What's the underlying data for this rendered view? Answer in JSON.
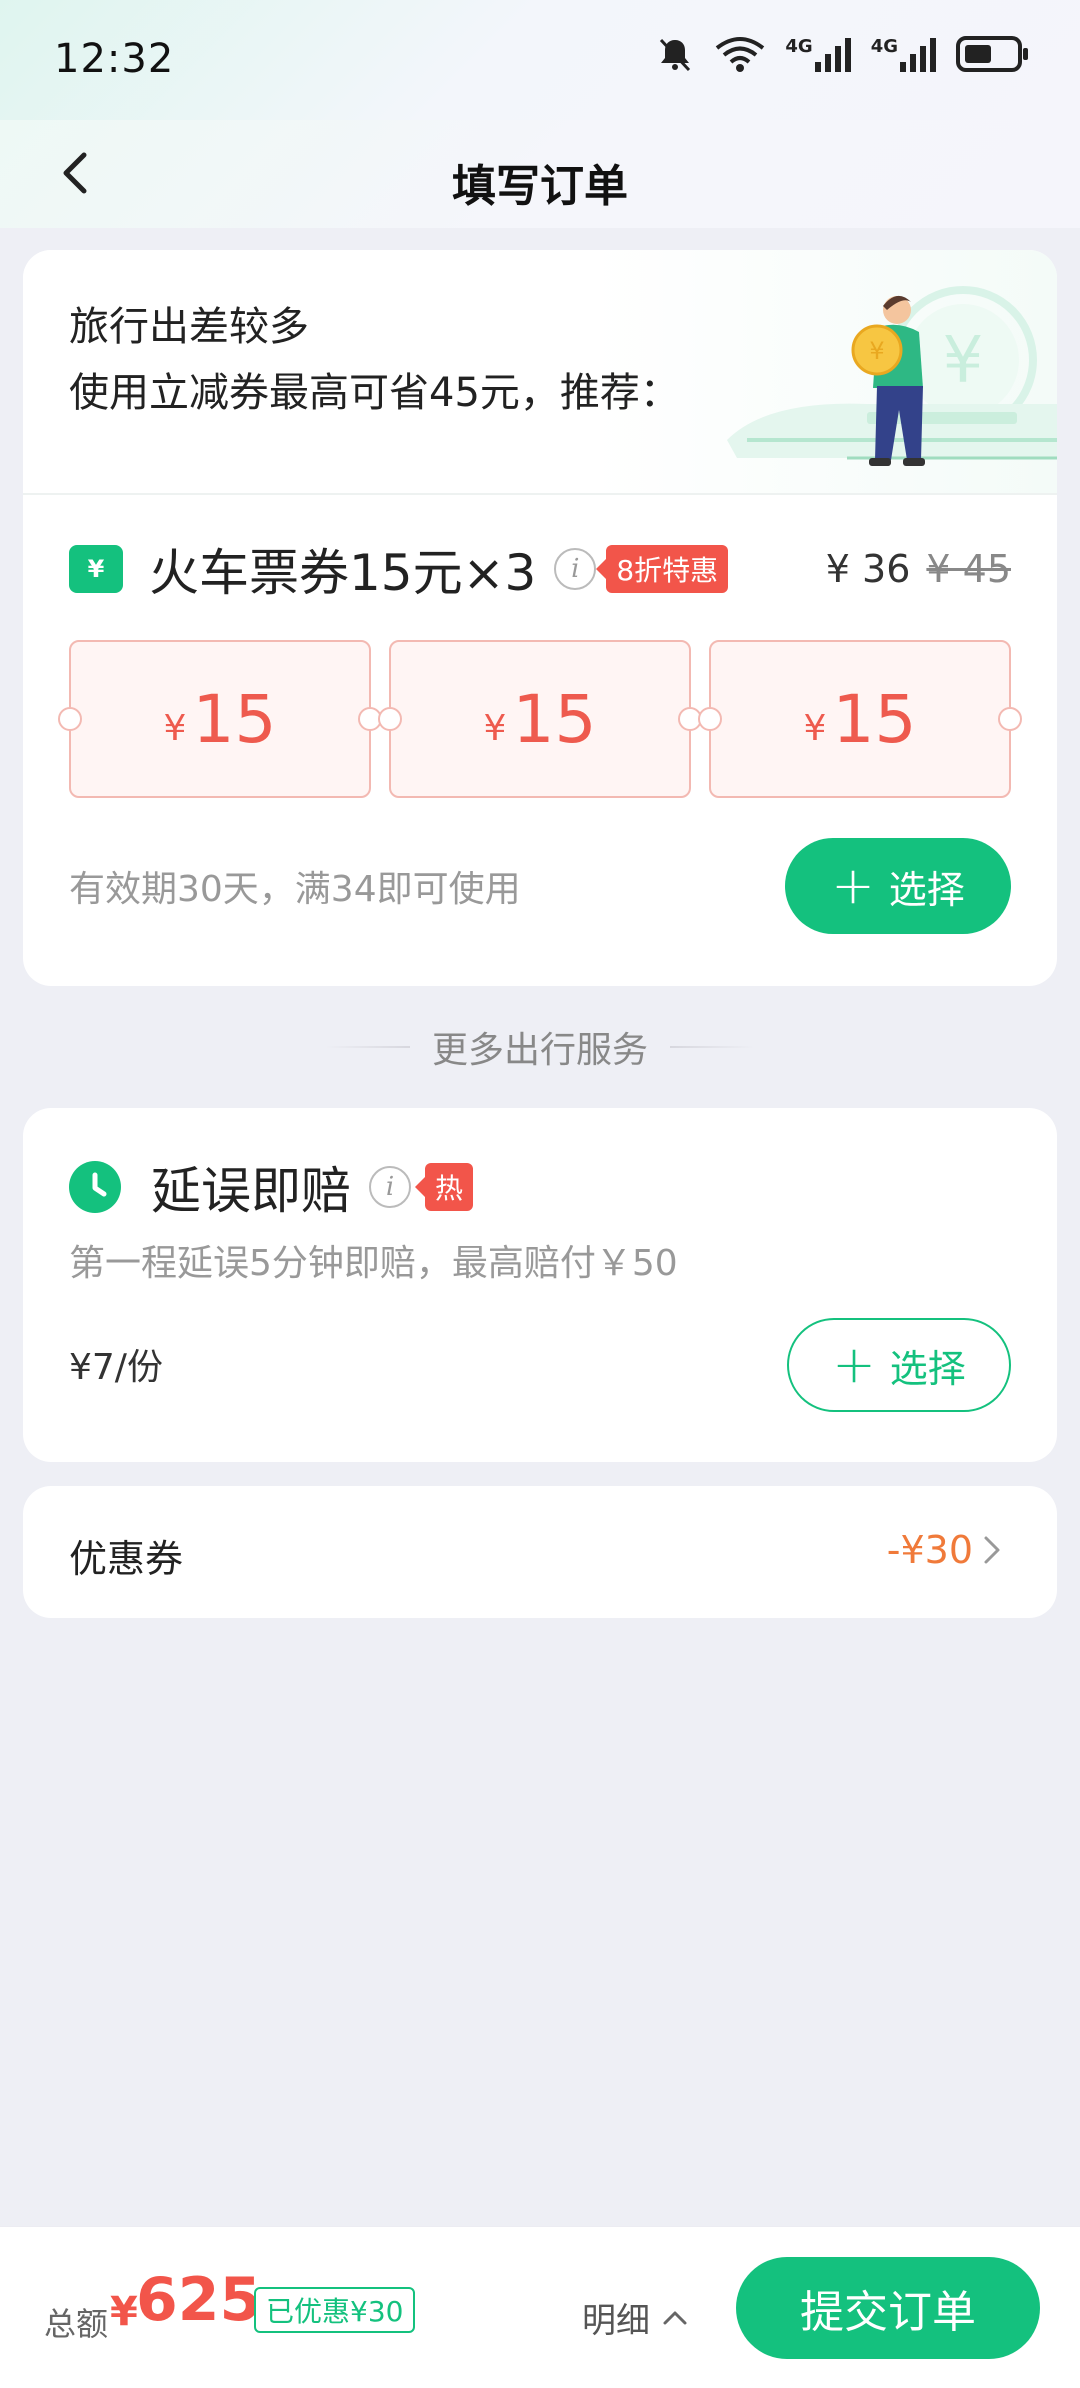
{
  "status_bar": {
    "time": "12:32",
    "icons": [
      "mute-bell-icon",
      "wifi-icon",
      "signal-4g-icon",
      "signal-4g-icon",
      "battery-icon"
    ],
    "network_labels": [
      "4G",
      "4G"
    ]
  },
  "header": {
    "title": "填写订单",
    "back_icon": "chevron-left-icon"
  },
  "promo": {
    "line1": "旅行出差较多",
    "line2": "使用立减券最高可省45元，推荐："
  },
  "coupon_package": {
    "title": "火车票券15元×3",
    "discount_badge": "8折特惠",
    "price_now": "¥ 36",
    "price_old": "¥ 45",
    "coupons": [
      {
        "currency": "¥",
        "amount": "15"
      },
      {
        "currency": "¥",
        "amount": "15"
      },
      {
        "currency": "¥",
        "amount": "15"
      }
    ],
    "validity": "有效期30天，满34即可使用",
    "select_label": "选择"
  },
  "section_divider": "更多出行服务",
  "delay_service": {
    "title": "延误即赔",
    "hot_badge": "热",
    "description": "第一程延误5分钟即赔，最高赔付￥50",
    "price": "¥7/份",
    "select_label": "选择"
  },
  "voucher": {
    "label": "优惠券",
    "value": "-¥30"
  },
  "bottom_bar": {
    "total_label": "总额",
    "currency": "¥",
    "total_amount": "625",
    "saved_badge": "已优惠¥30",
    "detail_label": "明细",
    "submit_label": "提交订单"
  },
  "colors": {
    "accent_green": "#14c17e",
    "price_red": "#f2554a",
    "voucher_orange": "#f07a3a",
    "page_background": "#eeeff5"
  }
}
